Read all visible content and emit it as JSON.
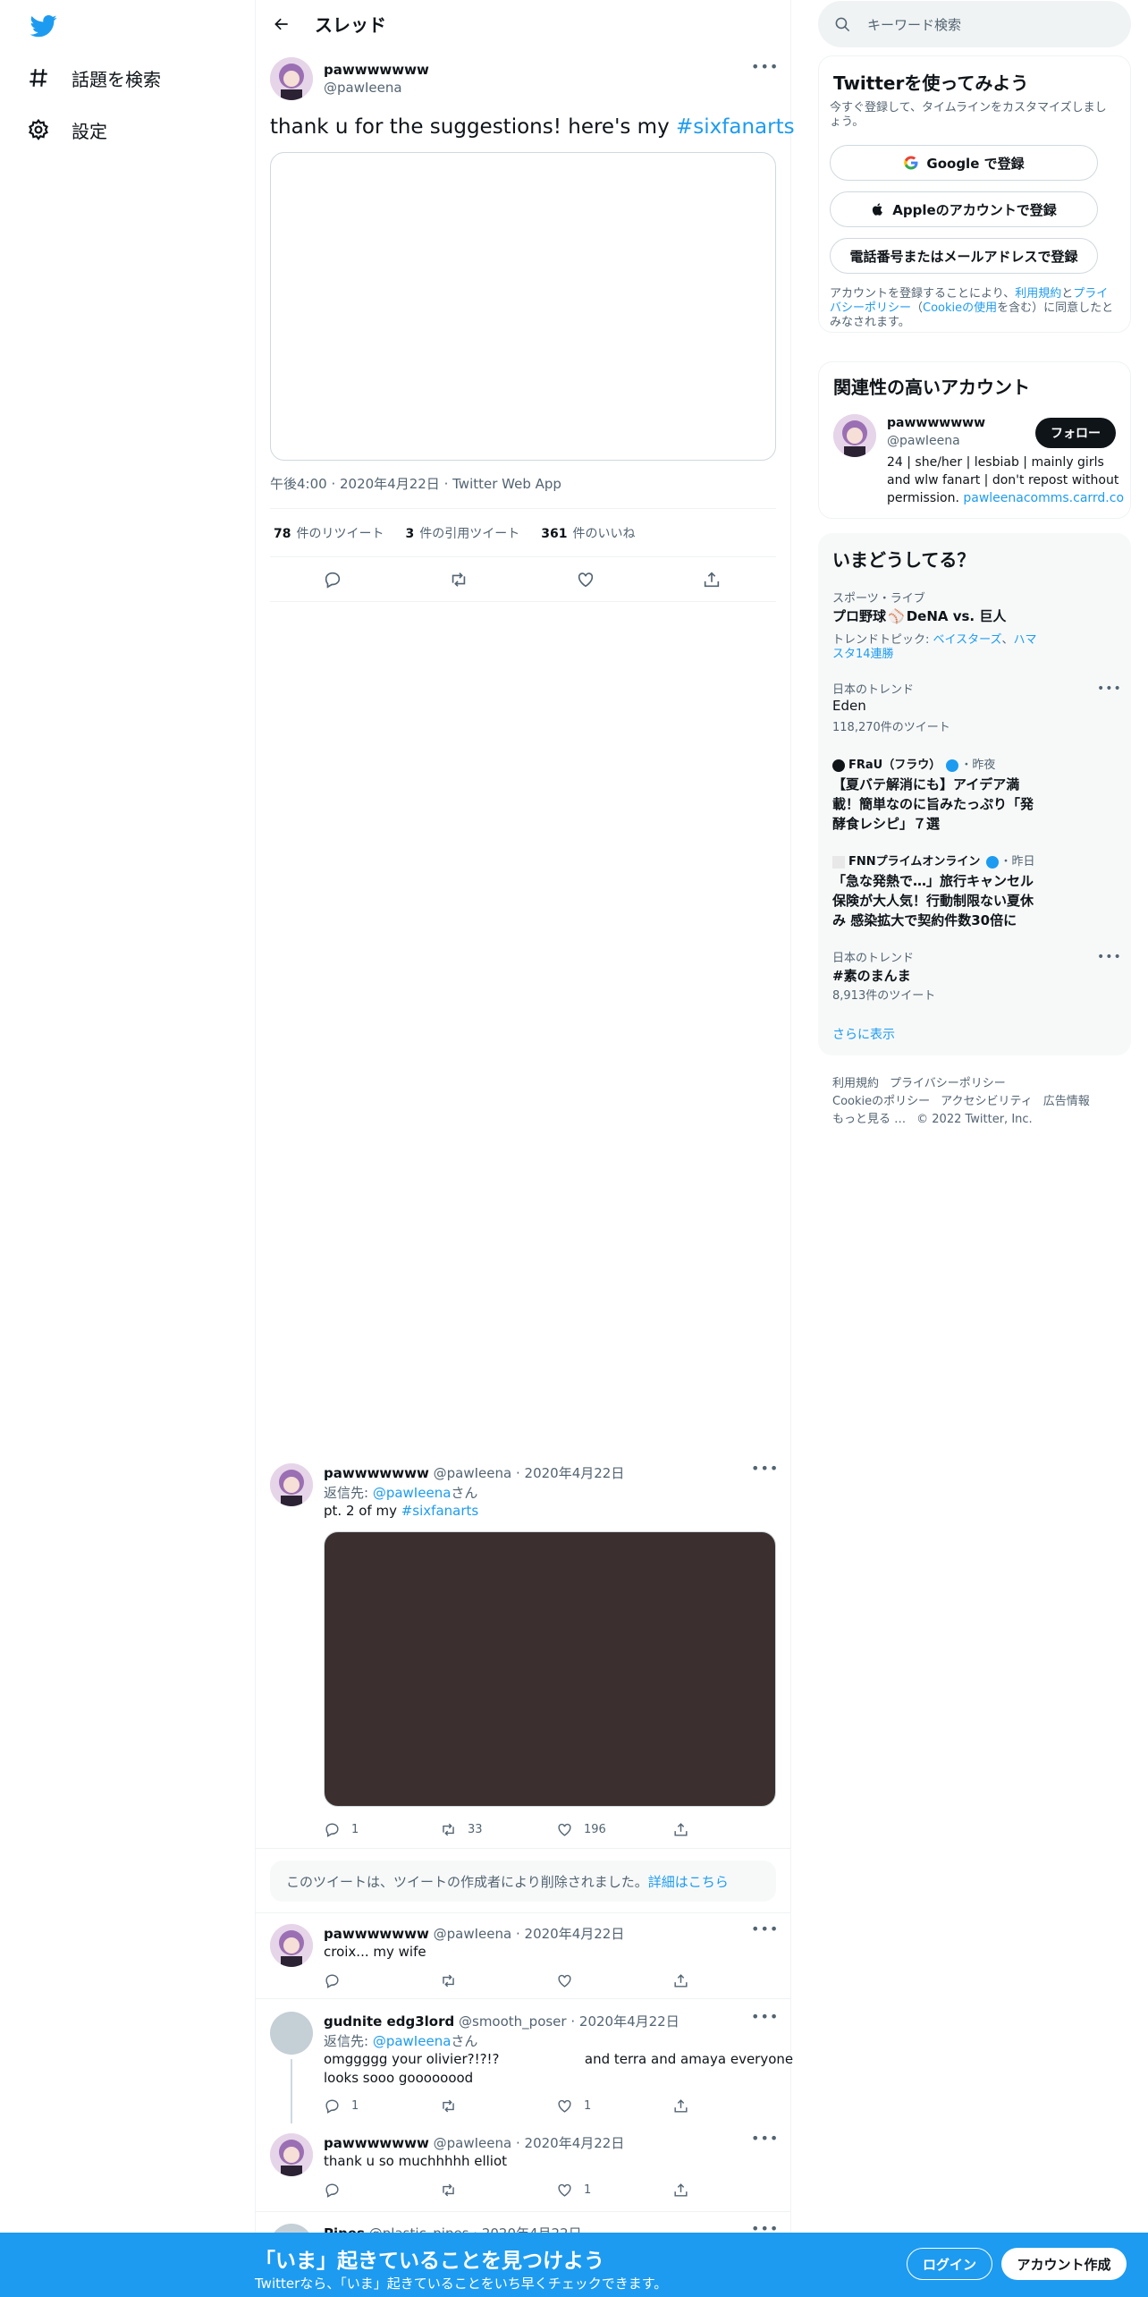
{
  "nav": {
    "logo": "twitter-bird-icon",
    "explore_label": "話題を検索",
    "settings_label": "設定"
  },
  "header": {
    "title": "スレッド"
  },
  "main_tweet": {
    "name": "pawwwwwww",
    "handle": "@pawIeena",
    "text": "thank u for the suggestions! here's my ",
    "hashtag": "#sixfanarts",
    "time": "午後4:00",
    "date": "2020年4月22日",
    "client": "Twitter Web App",
    "retweets": "78",
    "retweets_label": "件のリツイート",
    "quotes": "3",
    "quotes_label": "件の引用ツイート",
    "likes": "361",
    "likes_label": "件のいいね"
  },
  "replies": [
    {
      "name": "pawwwwwww",
      "handle": "@pawIeena",
      "date": "2020年4月22日",
      "reply_prefix": "返信先: ",
      "reply_to": "@pawIeena",
      "reply_suffix": "さん",
      "text": "pt. 2 of my ",
      "hashtag": "#sixfanarts",
      "replies": "1",
      "retweets": "33",
      "likes": "196"
    },
    {
      "deleted_text": "このツイートは、ツイートの作成者により削除されました。",
      "deleted_link": "詳細はこちら"
    },
    {
      "name": "pawwwwwww",
      "handle": "@pawIeena",
      "date": "2020年4月22日",
      "text": "croix... my wife"
    },
    {
      "name": "gudnite edg3lord",
      "handle": "@smooth_poser",
      "date": "2020年4月22日",
      "reply_prefix": "返信先: ",
      "reply_to": "@pawIeena",
      "reply_suffix": "さん",
      "text_line1": "omggggg your olivier?!?!?                    and terra and amaya everyone",
      "text_line2": "looks sooo goooooood",
      "replies": "1",
      "likes": "1"
    },
    {
      "name": "pawwwwwww",
      "handle": "@pawIeena",
      "date": "2020年4月22日",
      "text": "thank u so muchhhhh elliot",
      "likes": "1"
    },
    {
      "name": "Pipes",
      "handle": "@plastic_pipes",
      "date": "2020年4月22日"
    }
  ],
  "sidebar": {
    "search_placeholder": "キーワード検索",
    "signup": {
      "title": "Twitterを使ってみよう",
      "subtitle": "今すぐ登録して、タイムラインをカスタマイズしましょう。",
      "google": "Google で登録",
      "apple": "Appleのアカウントで登録",
      "phone": "電話番号またはメールアドレスで登録",
      "legal_1": "アカウントを登録することにより、",
      "legal_terms": "利用規約",
      "legal_2": "と",
      "legal_privacy": "プライバシーポリシー",
      "legal_3": "（",
      "legal_cookie": "Cookieの使用",
      "legal_4": "を含む）に同意したとみなされます。"
    },
    "related": {
      "title": "関連性の高いアカウント",
      "name": "pawwwwwww",
      "handle": "@pawIeena",
      "follow": "フォロー",
      "bio_1": "24 | she/her | lesbiab | mainly girls",
      "bio_2": "and wlw fanart | don't repost without",
      "bio_3": "permission. ",
      "bio_link": "pawleenacomms.carrd.co"
    },
    "trends": {
      "title": "いまどうしてる？",
      "items": [
        {
          "category": "スポーツ・ライブ",
          "title": "プロ野球",
          "title_rest": "DeNA vs. 巨人",
          "topic_label": "トレンドトピック: ",
          "topic_1": "ベイスターズ",
          "topic_sep": "、",
          "topic_2": "ハマ",
          "topic_3": "スタ14連勝"
        },
        {
          "category": "日本のトレンド",
          "title": "Eden",
          "count": "118,270件のツイート"
        },
        {
          "source": "FRaU（フラウ）",
          "when": "・昨夜",
          "line1": "【夏バテ解消にも】アイデア満",
          "line2": "載！簡単なのに旨みたっぷり「発",
          "line3": "酵食レシピ」７選"
        },
        {
          "source": "FNNプライムオンライン",
          "when": "・昨日",
          "line1": "「急な発熱で…」旅行キャンセル",
          "line2": "保険が大人気！行動制限ない夏休",
          "line3": "み 感染拡大で契約件数30倍に"
        },
        {
          "category": "日本のトレンド",
          "title": "#素のまんま",
          "count": "8,913件のツイート"
        }
      ],
      "show_more": "さらに表示"
    },
    "footer": {
      "terms": "利用規約",
      "privacy": "プライバシーポリシー",
      "cookie": "Cookieのポリシー",
      "accessibility": "アクセシビリティ",
      "ads": "広告情報",
      "more": "もっと見る …",
      "copyright": "© 2022 Twitter, Inc."
    }
  },
  "bottom_bar": {
    "title": "「いま」起きていることを見つけよう",
    "subtitle": "Twitterなら、「いま」起きていることをいち早くチェックできます。",
    "login": "ログイン",
    "signup": "アカウント作成"
  },
  "colors": {
    "accent": "#1d9bf0",
    "text": "#0f1419",
    "muted": "#536471",
    "border": "#eff3f4",
    "media_dark": "#3b302f"
  }
}
